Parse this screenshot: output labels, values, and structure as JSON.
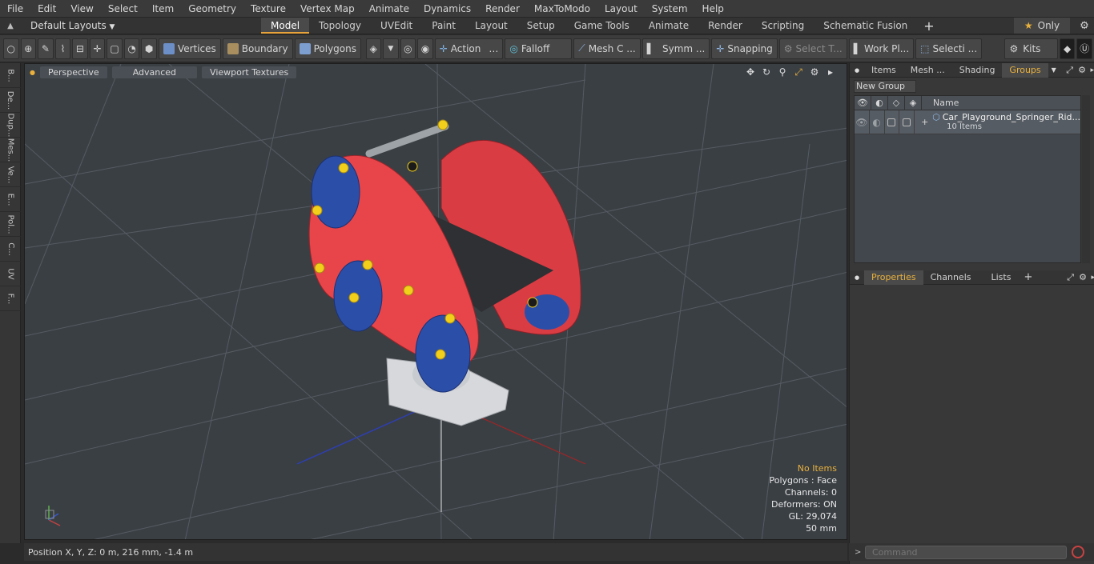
{
  "menu": [
    "File",
    "Edit",
    "View",
    "Select",
    "Item",
    "Geometry",
    "Texture",
    "Vertex Map",
    "Animate",
    "Dynamics",
    "Render",
    "MaxToModo",
    "Layout",
    "System",
    "Help"
  ],
  "layouts_label": "Default Layouts",
  "tabs": [
    "Model",
    "Topology",
    "UVEdit",
    "Paint",
    "Layout",
    "Setup",
    "Game Tools",
    "Animate",
    "Render",
    "Scripting",
    "Schematic Fusion"
  ],
  "active_tab": "Model",
  "only_label": "Only",
  "toolbar": {
    "vertices": "Vertices",
    "boundary": "Boundary",
    "polygons": "Polygons",
    "action": "Action",
    "falloff": "Falloff",
    "mesh": "Mesh C ...",
    "symm": "Symm ...",
    "snapping": "Snapping",
    "select_t": "Select T...",
    "work_pl": "Work Pl...",
    "selecti": "Selecti ...",
    "kits": "Kits"
  },
  "left_tabs": [
    "B...",
    "De...",
    "Dup...",
    "Mes...",
    "Ve...",
    "E...",
    "Pol...",
    "C...",
    "UV",
    "F..."
  ],
  "viewport": {
    "perspective": "Perspective",
    "advanced": "Advanced",
    "textures": "Viewport Textures",
    "info": {
      "selection": "No Items",
      "polygons": "Polygons : Face",
      "channels": "Channels: 0",
      "deformers": "Deformers: ON",
      "gl": "GL: 29,074",
      "scale": "50 mm"
    }
  },
  "status": {
    "position": "Position X, Y, Z:   0 m, 216 mm, -1.4 m"
  },
  "panel": {
    "tabs": [
      "Items",
      "Mesh ...",
      "Shading",
      "Groups"
    ],
    "active": "Groups",
    "new_group": "New Group",
    "name_col": "Name",
    "group_name": "Car_Playground_Springer_Rid...",
    "group_count": "10 Items"
  },
  "props": {
    "tabs": [
      "Properties",
      "Channels",
      "Lists"
    ],
    "active": "Properties"
  },
  "command": {
    "placeholder": "Command"
  },
  "colors": {
    "accent": "#e9b13c",
    "body_red": "#e8454a",
    "wheel_blue": "#2b4fa8"
  }
}
